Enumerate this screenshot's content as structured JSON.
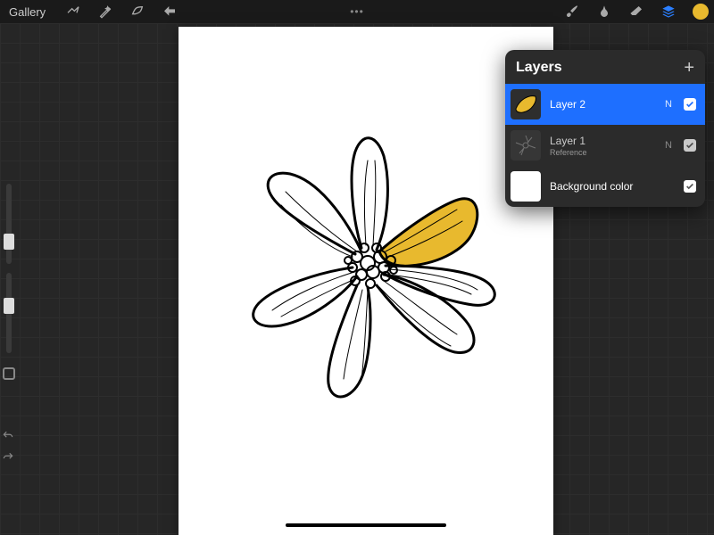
{
  "toolbar": {
    "gallery_label": "Gallery"
  },
  "colors": {
    "active_color": "#e8b92e",
    "accent_blue": "#1e6fff"
  },
  "layers_panel": {
    "title": "Layers",
    "layers": [
      {
        "name": "Layer 2",
        "blend": "N",
        "visible": true,
        "selected": true,
        "thumb": "petal"
      },
      {
        "name": "Layer 1",
        "subtitle": "Reference",
        "blend": "N",
        "visible": true,
        "selected": false,
        "thumb": "flower"
      },
      {
        "name": "Background color",
        "blend": "",
        "visible": true,
        "selected": false,
        "thumb": "white"
      }
    ]
  }
}
